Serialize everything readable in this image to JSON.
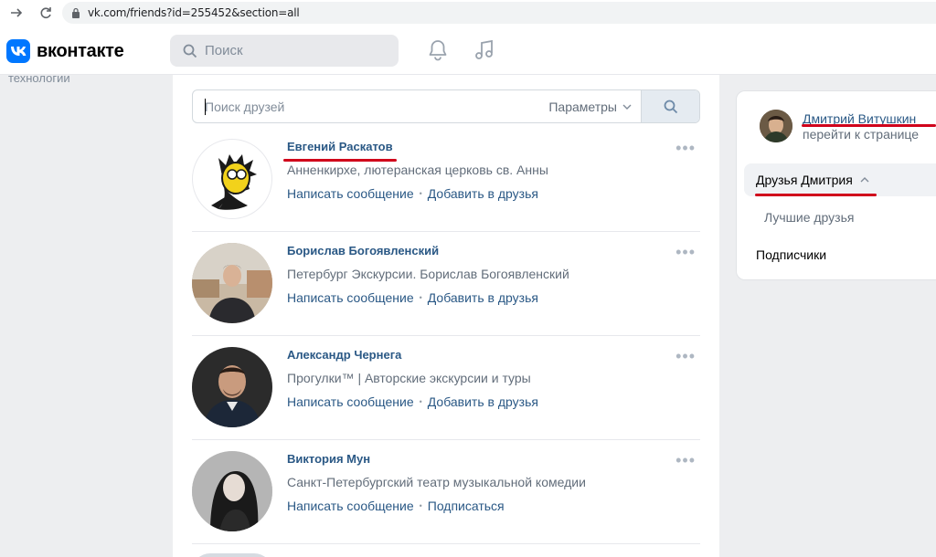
{
  "browser": {
    "url": "vk.com/friends?id=255452&section=all"
  },
  "header": {
    "logo_text": "вконтакте",
    "search_placeholder": "Поиск"
  },
  "left": {
    "partial_text": "технологии"
  },
  "friends_search": {
    "placeholder": "Поиск друзей",
    "params_label": "Параметры"
  },
  "friends": [
    {
      "name": "Евгений Раскатов",
      "description": "Анненкирхе, лютеранская церковь св. Анны",
      "action1": "Написать сообщение",
      "action2": "Добавить в друзья"
    },
    {
      "name": "Борислав Богоявленский",
      "description": "Петербург Экскурсии. Борислав Богоявленский",
      "action1": "Написать сообщение",
      "action2": "Добавить в друзья"
    },
    {
      "name": "Александр Чернега",
      "description": "Прогулки™ | Авторские экскурсии и туры",
      "action1": "Написать сообщение",
      "action2": "Добавить в друзья"
    },
    {
      "name": "Виктория Мун",
      "description": "Санкт-Петербургский театр музыкальной комедии",
      "action1": "Написать сообщение",
      "action2": "Подписаться"
    }
  ],
  "right_panel": {
    "name": "Дмитрий Витушкин",
    "subtitle": "перейти к странице",
    "active_item": "Друзья Дмитрия",
    "sub_item": "Лучшие друзья",
    "item": "Подписчики"
  },
  "colors": {
    "accent": "#0077ff",
    "link": "#2a5885",
    "annotation": "#d0021b"
  }
}
